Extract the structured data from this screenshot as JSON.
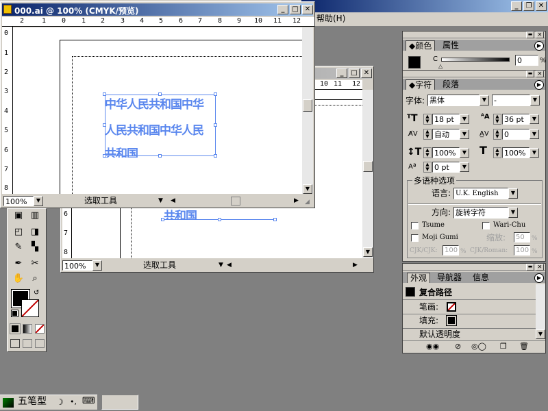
{
  "menu": {
    "help_label": "帮助(H)"
  },
  "app_controls": {
    "min": "_",
    "restore": "❐",
    "close": "✕"
  },
  "doc_front": {
    "title": "000.ai @ 100% (CMYK/预览)",
    "ruler_h": [
      "2",
      "1",
      "0",
      "1",
      "2",
      "3",
      "4",
      "5",
      "6",
      "7",
      "8",
      "9",
      "10",
      "11",
      "12"
    ],
    "ruler_v": [
      "0",
      "1",
      "2",
      "3",
      "4",
      "5",
      "6",
      "7",
      "8"
    ],
    "zoom": "100%",
    "tool_status": "选取工具",
    "text_lines": [
      "中华人民共和国中华",
      "人民共和国中华人民",
      "共和国"
    ]
  },
  "doc_back": {
    "ruler_h": [
      "10",
      "11",
      "12"
    ],
    "ruler_v": [
      "6",
      "7",
      "8"
    ],
    "zoom": "100%",
    "tool_status": "选取工具",
    "text_line": "共和国"
  },
  "color_panel": {
    "tabs": [
      "颜色",
      "属性"
    ],
    "channel": "C",
    "value": "0",
    "unit": "%"
  },
  "char_panel": {
    "tabs": [
      "字符",
      "段落"
    ],
    "font_label": "字体:",
    "font_value": "黑体",
    "style_value": "-",
    "size": "18 pt",
    "leading": "36 pt",
    "kerning": "自动",
    "tracking": "0",
    "v_scale": "100%",
    "h_scale": "100%",
    "baseline": "0 pt",
    "multilang_header": "多语种选项",
    "language_label": "语言:",
    "language_value": "U.K. English",
    "direction_label": "方向:",
    "direction_value": "旋转字符",
    "tsume": "Tsume",
    "wari_chu": "Wari-Chu",
    "moji_gumi": "Moji Gumi",
    "scale_label": "缩放:",
    "scale_value": "50",
    "cjk_cjk_label": "CJK/CJK:",
    "cjk_cjk_value": "100",
    "cjk_roman_label": "CJK/Roman:",
    "cjk_roman_value": "100",
    "pct": "%"
  },
  "appearance_panel": {
    "tabs": [
      "外观",
      "导航器",
      "信息"
    ],
    "object": "复合路径",
    "stroke_label": "笔画:",
    "fill_label": "填充:",
    "opacity": "默认透明度"
  },
  "taskbar": {
    "ime_name": "五笔型",
    "moon": "☽",
    "dot": "•,",
    "keyboard": "⌨"
  },
  "colors": {
    "title_active": "#0a246a",
    "title_end": "#a6caf0",
    "selection": "#5a87ee",
    "desktop": "#808080"
  }
}
